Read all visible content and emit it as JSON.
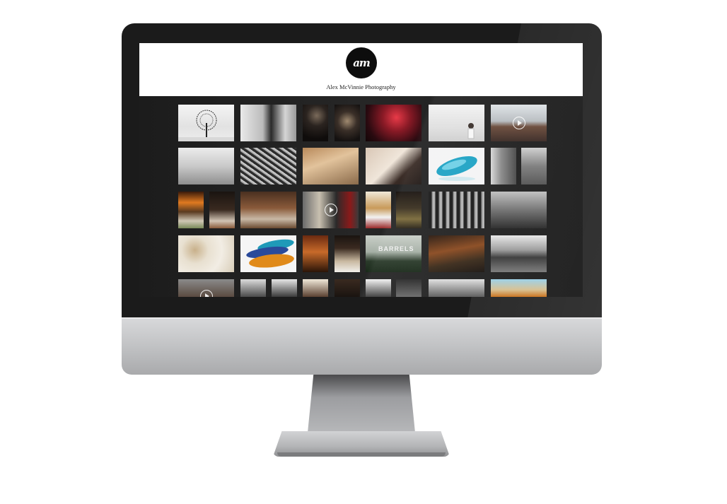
{
  "site": {
    "logo_text": "am",
    "title": "Alex McVinnie Photography"
  },
  "gallery": {
    "thumbnails": [
      {
        "subject": "bare tree in snow",
        "video": false
      },
      {
        "subject": "falconer with bird",
        "video": false
      },
      {
        "subject": "portrait in dark",
        "video": false
      },
      {
        "subject": "red smoke flare",
        "video": false
      },
      {
        "subject": "bride at window",
        "video": false
      },
      {
        "subject": "man speaking",
        "video": true
      },
      {
        "subject": "workers at table",
        "video": false
      },
      {
        "subject": "tree branches",
        "video": false
      },
      {
        "subject": "canapes platter",
        "video": false
      },
      {
        "subject": "chef plating dessert",
        "video": false
      },
      {
        "subject": "blue glass bowl",
        "video": false
      },
      {
        "subject": "woman at window",
        "video": false
      },
      {
        "subject": "fireplace and dish",
        "video": false
      },
      {
        "subject": "wine and plated dinner",
        "video": false
      },
      {
        "subject": "kitchen service",
        "video": true
      },
      {
        "subject": "cocktail and appetizer",
        "video": false
      },
      {
        "subject": "workshop tools",
        "video": false
      },
      {
        "subject": "factory workers",
        "video": false
      },
      {
        "subject": "mushrooms on linen",
        "video": false
      },
      {
        "subject": "colored glass bowls",
        "video": false
      },
      {
        "subject": "wine cellar and dish",
        "video": false
      },
      {
        "subject": "forest with title",
        "video": false
      },
      {
        "subject": "copper still",
        "video": false
      },
      {
        "subject": "ocean wave",
        "video": false
      },
      {
        "subject": "video still",
        "video": true
      },
      {
        "subject": "film portraits",
        "video": false
      },
      {
        "subject": "portrait pair",
        "video": false
      },
      {
        "subject": "person and machine",
        "video": false
      },
      {
        "subject": "misty landscape",
        "video": false
      },
      {
        "subject": "coastal cliff",
        "video": false
      }
    ],
    "forest_overlay_text": "BARRELS"
  }
}
